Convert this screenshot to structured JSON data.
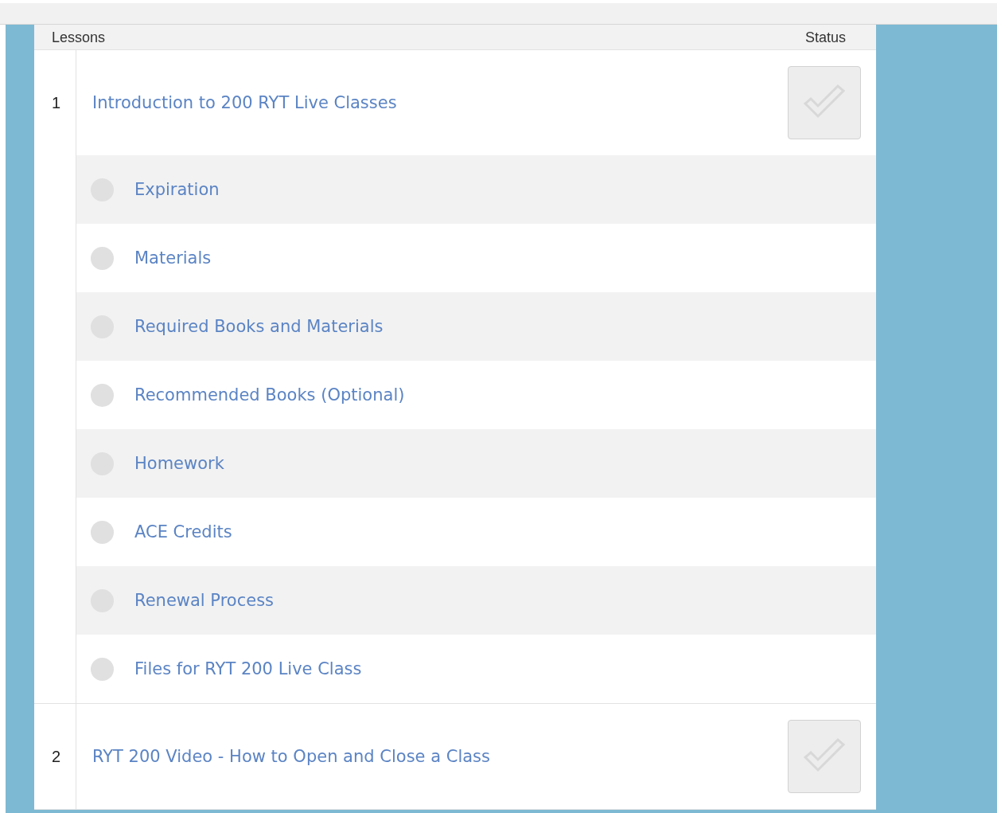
{
  "table": {
    "columns": [
      "Lessons",
      "Status"
    ],
    "lessons": [
      {
        "number": "1",
        "title": "Introduction to 200 RYT Live Classes",
        "completed": false,
        "topics": [
          {
            "title": "Expiration",
            "completed": false
          },
          {
            "title": "Materials",
            "completed": false
          },
          {
            "title": "Required Books and Materials",
            "completed": false
          },
          {
            "title": "Recommended Books (Optional)",
            "completed": false
          },
          {
            "title": "Homework",
            "completed": false
          },
          {
            "title": "ACE Credits",
            "completed": false
          },
          {
            "title": "Renewal Process",
            "completed": false
          },
          {
            "title": "Files for RYT 200 Live Class",
            "completed": false
          }
        ]
      },
      {
        "number": "2",
        "title": "RYT 200 Video - How to Open and Close a Class",
        "completed": false
      }
    ]
  }
}
